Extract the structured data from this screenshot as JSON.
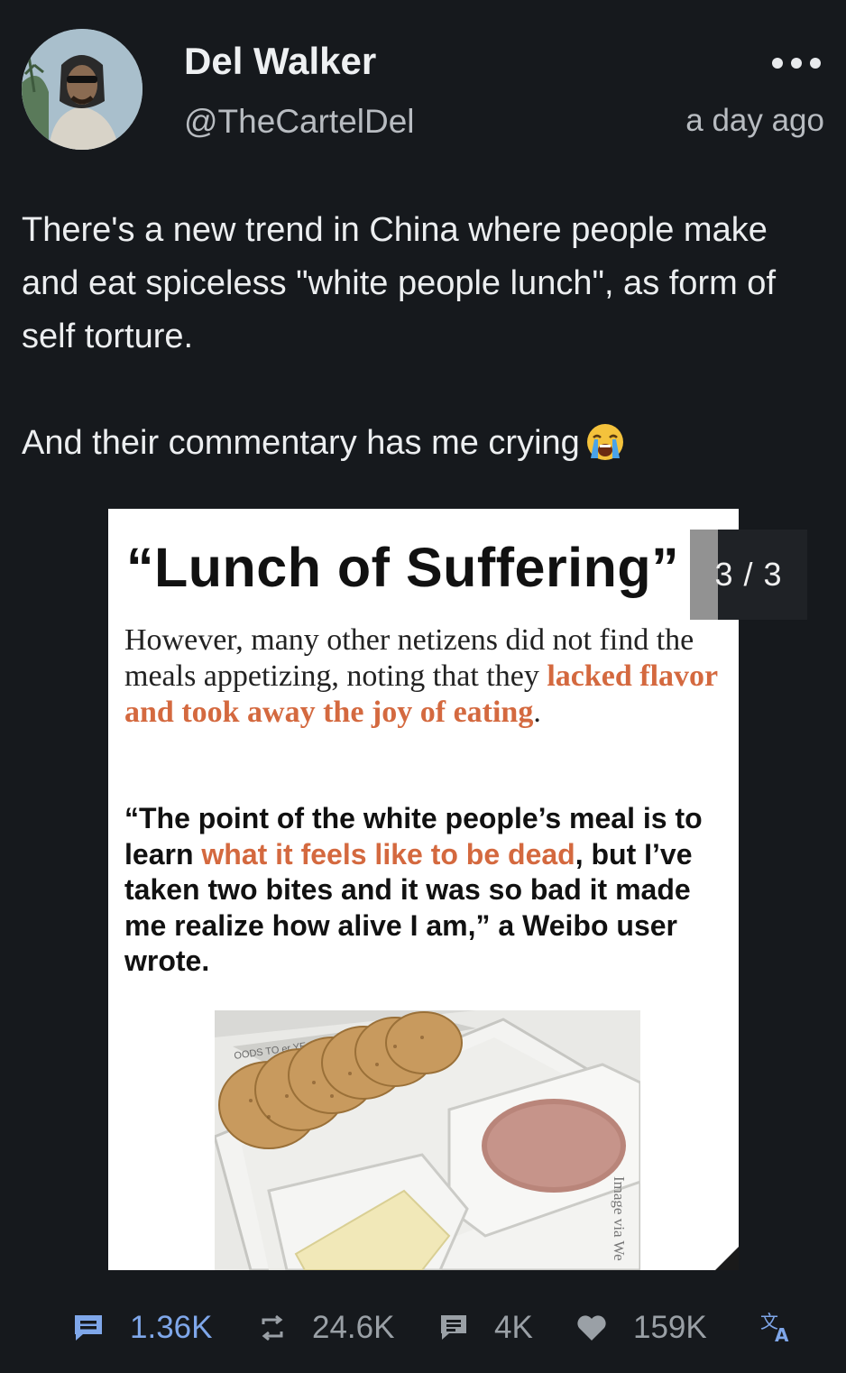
{
  "post": {
    "author_name": "Del Walker",
    "author_handle": "@TheCartelDel",
    "timestamp": "a day ago",
    "text_p1": "There's a new trend in China where people make and eat spiceless \"white people lunch\", as form of self torture.",
    "text_p2": "And their commentary has me crying",
    "emoji": "loudly-crying-face-emoji"
  },
  "media": {
    "counter": "3 / 3",
    "title": "“Lunch of Suffering”",
    "para1_plain": "However, many other netizens did not find the meals appetizing, noting that they ",
    "para1_accent": "lacked flavor and took away the joy of eating",
    "para1_end": ".",
    "para2_start": "“The point of the white people’s meal is to learn ",
    "para2_accent": "what it feels like to be dead",
    "para2_end": ", but I’ve taken two bites and it was so bad it made me realize how alive I am,” a Weibo user wrote.",
    "image_caption": "Image via We",
    "box_text": "OODS TO er YE"
  },
  "actions": {
    "replies": "1.36K",
    "reposts": "24.6K",
    "quotes": "4K",
    "likes": "159K"
  },
  "colors": {
    "background": "#16191d",
    "accent_orange": "#d4693f",
    "reply_blue": "#7fa7ea",
    "muted": "#9aa0a6"
  },
  "icons": [
    "more-icon",
    "reply-icon",
    "repost-icon",
    "quote-icon",
    "heart-icon",
    "translate-icon"
  ]
}
